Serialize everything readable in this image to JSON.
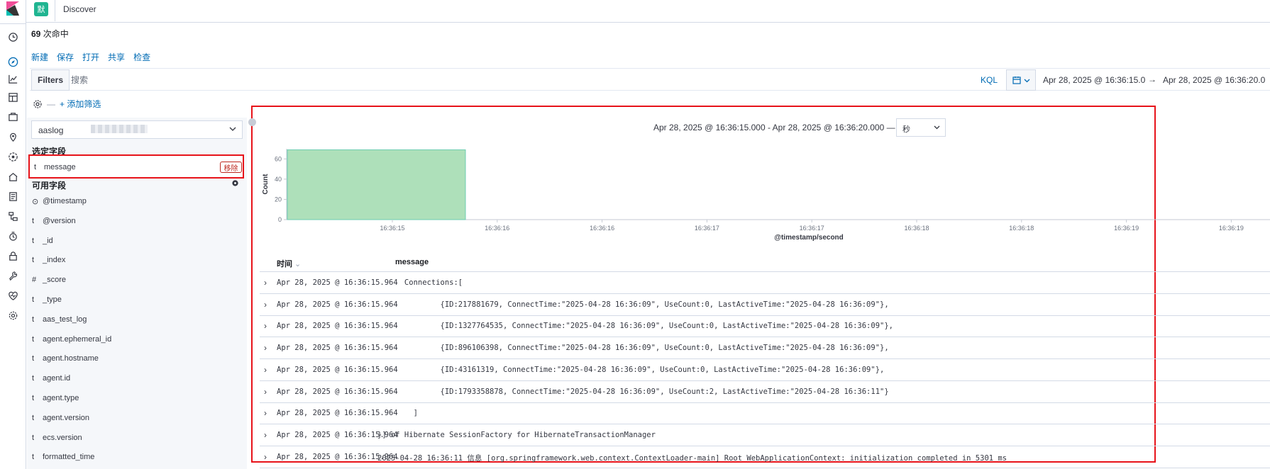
{
  "app": {
    "space_badge": "默",
    "breadcrumb": "Discover"
  },
  "hits": {
    "count": "69",
    "label": " 次命中"
  },
  "menu": [
    "新建",
    "保存",
    "打开",
    "共享",
    "检查"
  ],
  "query": {
    "filters_label": "Filters",
    "search_placeholder": "搜索",
    "language": "KQL",
    "date_start": "Apr 28, 2025 @ 16:36:15.0",
    "date_arrow": "→",
    "date_end": "Apr 28, 2025 @ 16:36:20.0"
  },
  "filter_bar": {
    "add_filter": "+ 添加筛选"
  },
  "sidebar": {
    "index_pattern": "aaslog",
    "selected_title": "选定字段",
    "selected_fields": [
      {
        "type": "t",
        "name": "message",
        "remove_label": "移除"
      }
    ],
    "available_title": "可用字段",
    "available_fields": [
      {
        "type": "⊙",
        "name": "@timestamp"
      },
      {
        "type": "t",
        "name": "@version"
      },
      {
        "type": "t",
        "name": "_id"
      },
      {
        "type": "t",
        "name": "_index"
      },
      {
        "type": "#",
        "name": "_score"
      },
      {
        "type": "t",
        "name": "_type"
      },
      {
        "type": "t",
        "name": "aas_test_log"
      },
      {
        "type": "t",
        "name": "agent.ephemeral_id"
      },
      {
        "type": "t",
        "name": "agent.hostname"
      },
      {
        "type": "t",
        "name": "agent.id"
      },
      {
        "type": "t",
        "name": "agent.type"
      },
      {
        "type": "t",
        "name": "agent.version"
      },
      {
        "type": "t",
        "name": "ecs.version"
      },
      {
        "type": "t",
        "name": "formatted_time"
      }
    ]
  },
  "histogram": {
    "range_title": "Apr 28, 2025 @ 16:36:15.000 - Apr 28, 2025 @ 16:36:20.000 —",
    "interval": "秒"
  },
  "chart_data": {
    "type": "bar",
    "categories": [
      "16:36:15"
    ],
    "values": [
      69
    ],
    "bar_color": "#aee0ba",
    "bar_border": "#6dccb1",
    "ylabel": "Count",
    "xlabel": "@timestamp/second",
    "ylim": [
      0,
      70
    ],
    "y_ticks": [
      0,
      20,
      40,
      60
    ],
    "x_ticks": [
      "16:36:15",
      "16:36:16",
      "16:36:16",
      "16:36:17",
      "16:36:17",
      "16:36:18",
      "16:36:18",
      "16:36:19",
      "16:36:19"
    ]
  },
  "table": {
    "col_time": "时间",
    "col_message": "message",
    "rows": [
      {
        "time": "Apr 28, 2025 @ 16:36:15.964",
        "message": "      Connections:["
      },
      {
        "time": "Apr 28, 2025 @ 16:36:15.964",
        "message": "              {ID:217881679, ConnectTime:\"2025-04-28 16:36:09\", UseCount:0, LastActiveTime:\"2025-04-28 16:36:09\"},"
      },
      {
        "time": "Apr 28, 2025 @ 16:36:15.964",
        "message": "              {ID:1327764535, ConnectTime:\"2025-04-28 16:36:09\", UseCount:0, LastActiveTime:\"2025-04-28 16:36:09\"},"
      },
      {
        "time": "Apr 28, 2025 @ 16:36:15.964",
        "message": "              {ID:896106398, ConnectTime:\"2025-04-28 16:36:09\", UseCount:0, LastActiveTime:\"2025-04-28 16:36:09\"},"
      },
      {
        "time": "Apr 28, 2025 @ 16:36:15.964",
        "message": "              {ID:43161319, ConnectTime:\"2025-04-28 16:36:09\", UseCount:0, LastActiveTime:\"2025-04-28 16:36:09\"},"
      },
      {
        "time": "Apr 28, 2025 @ 16:36:15.964",
        "message": "              {ID:1793358878, ConnectTime:\"2025-04-28 16:36:09\", UseCount:2, LastActiveTime:\"2025-04-28 16:36:11\"}"
      },
      {
        "time": "Apr 28, 2025 @ 16:36:15.964",
        "message": "        ]"
      },
      {
        "time": "Apr 28, 2025 @ 16:36:15.964",
        "message": "}] of Hibernate SessionFactory for HibernateTransactionManager"
      },
      {
        "time": "Apr 28, 2025 @ 16:36:15.964",
        "message": "2025-04-28 16:36:11 信息 [org.springframework.web.context.ContextLoader-main] Root WebApplicationContext: initialization completed in 5301 ms"
      }
    ]
  }
}
